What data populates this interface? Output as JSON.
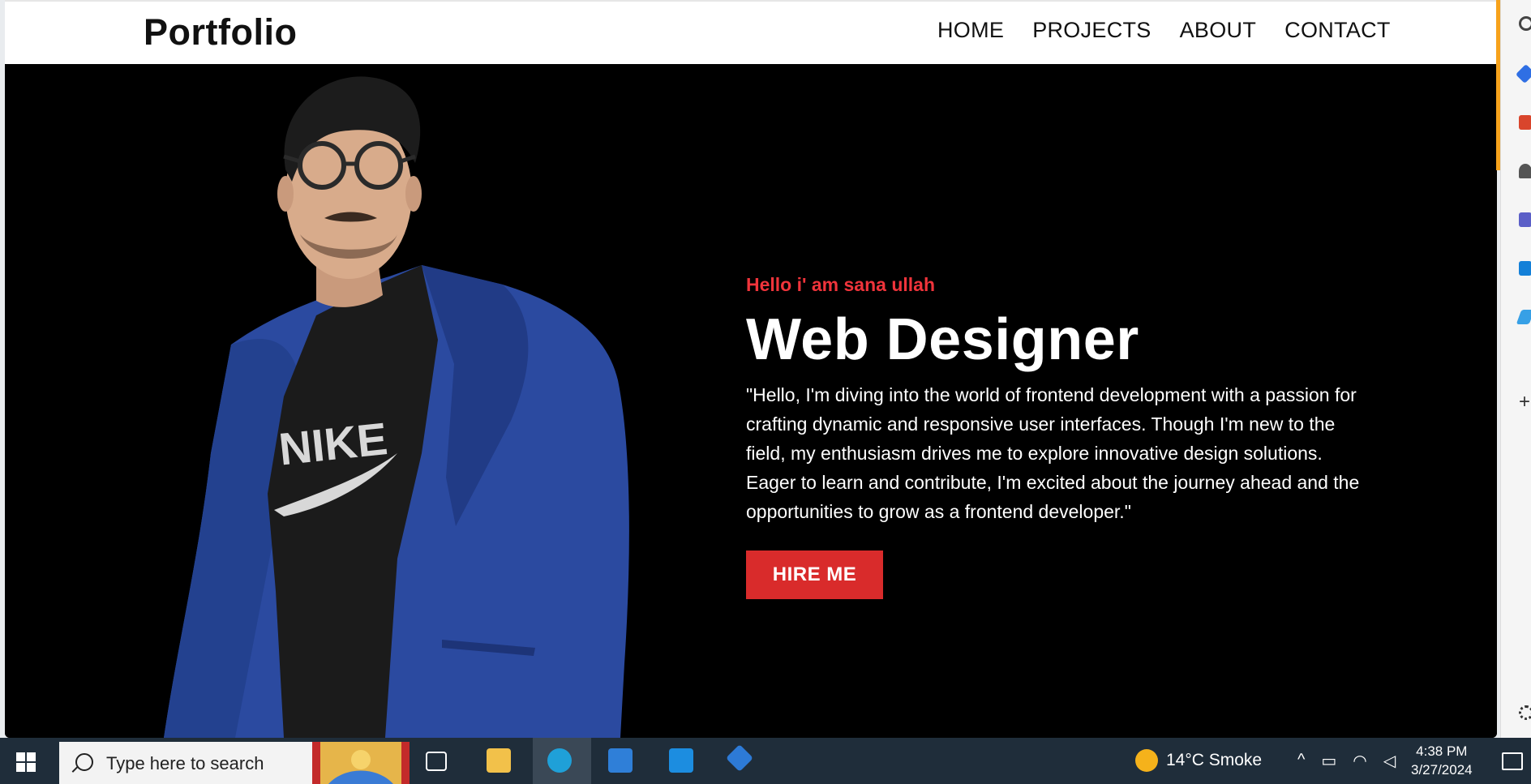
{
  "navbar": {
    "brand": "Portfolio",
    "links": [
      "HOME",
      "PROJECTS",
      "ABOUT",
      "CONTACT"
    ]
  },
  "hero": {
    "greeting": "Hello i' am sana ullah",
    "title": "Web Designer",
    "description": "\"Hello, I'm diving into the world of frontend development with a passion for crafting dynamic and responsive user interfaces. Though I'm new to the field, my enthusiasm drives me to explore innovative design solutions. Eager to learn and contribute, I'm excited about the journey ahead and the opportunities to grow as a frontend developer.\"",
    "button": "HIRE ME",
    "shirt_text": "NIKE"
  },
  "taskbar": {
    "search_placeholder": "Type here to search",
    "weather": "14°C  Smoke",
    "time": "4:38 PM",
    "date": "3/27/2024",
    "apps": [
      "task-view",
      "file-explorer",
      "edge",
      "microsoft-store",
      "mail",
      "vscode"
    ]
  },
  "colors": {
    "accent_red": "#d92b2b",
    "greeting_red": "#f0343b",
    "blazer_blue": "#2b4aa0",
    "taskbar": "#1f2d3a"
  }
}
